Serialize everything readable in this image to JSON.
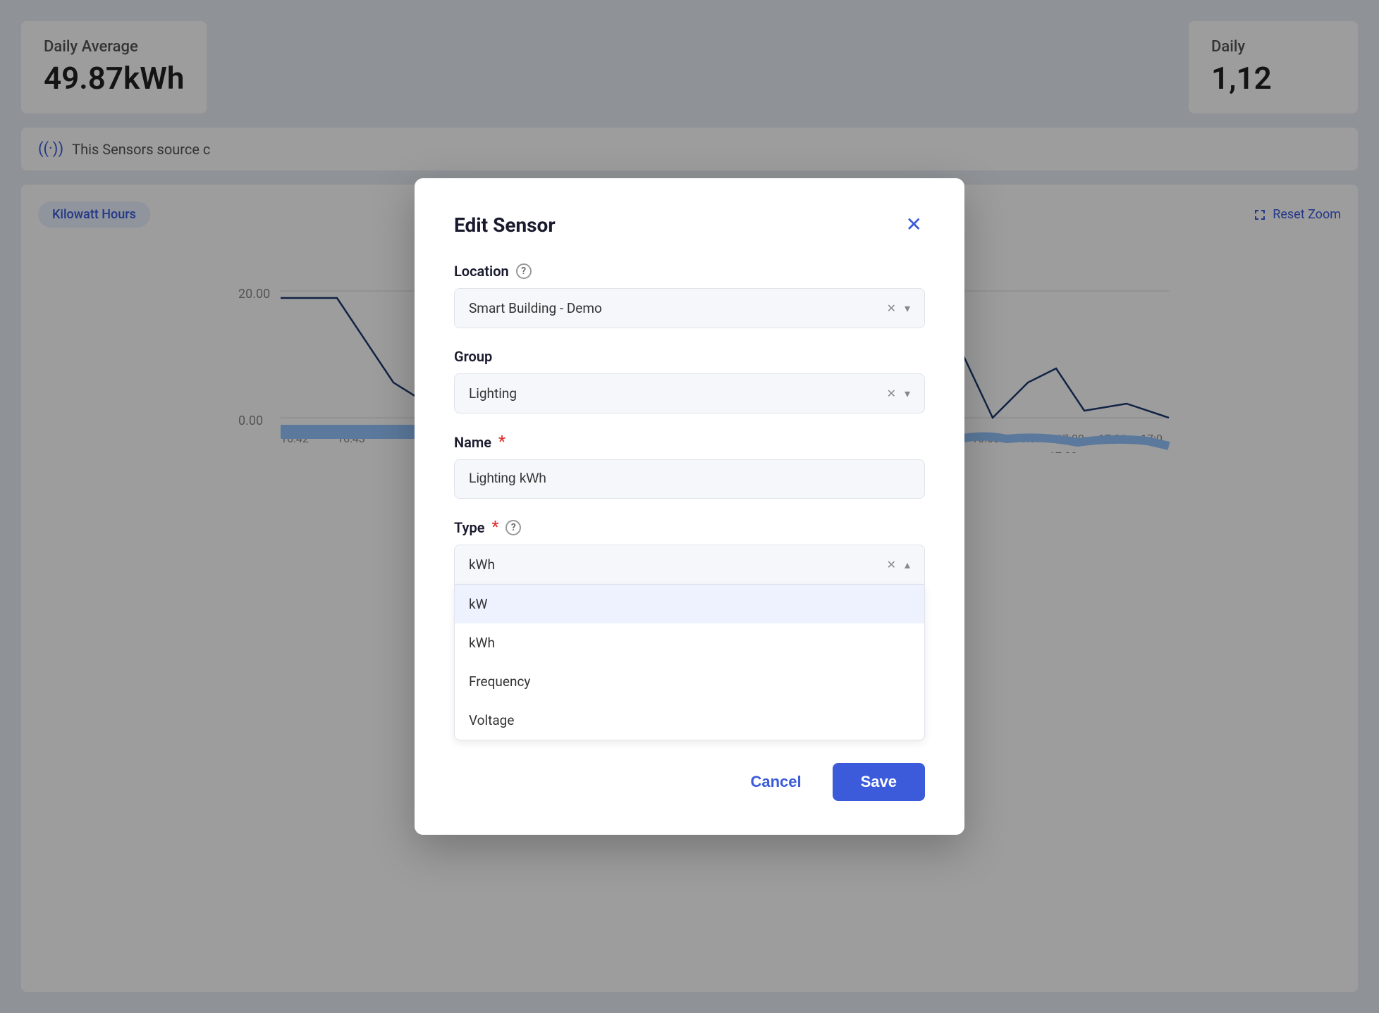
{
  "dashboard": {
    "card1": {
      "label": "Daily Average",
      "value": "49.87kWh"
    },
    "card2": {
      "label": "Daily",
      "value": "1,12"
    },
    "sensor_bar": "This Sensors source c",
    "kwh_badge": "Kilowatt Hours",
    "reset_zoom": "Reset Zoom",
    "chart_y_labels": [
      "20.00",
      "0.00"
    ],
    "chart_x_labels": [
      "16:42",
      "16:43",
      "16:58",
      "16:59",
      "17:00",
      "17:01",
      "17:0"
    ]
  },
  "modal": {
    "title": "Edit Sensor",
    "close_icon": "✕",
    "location_label": "Location",
    "location_value": "Smart Building - Demo",
    "group_label": "Group",
    "group_value": "Lighting",
    "name_label": "Name",
    "name_required": true,
    "name_value": "Lighting kWh",
    "type_label": "Type",
    "type_required": true,
    "type_value": "kWh",
    "type_options": [
      {
        "label": "kW",
        "highlighted": true
      },
      {
        "label": "kWh",
        "highlighted": false
      },
      {
        "label": "Frequency",
        "highlighted": false
      },
      {
        "label": "Voltage",
        "highlighted": false
      }
    ],
    "cancel_label": "Cancel",
    "save_label": "Save"
  }
}
